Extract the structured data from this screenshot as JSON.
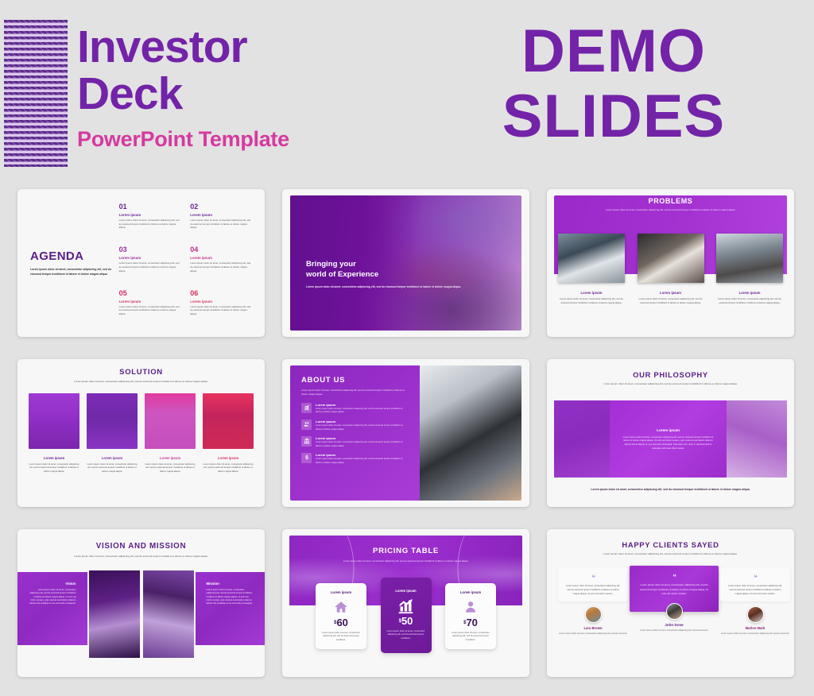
{
  "header": {
    "title_line1": "Investor",
    "title_line2": "Deck",
    "subtitle": "PowerPoint Template",
    "demo_line1": "DEMO",
    "demo_line2": "SLIDES",
    "colors": {
      "purple": "#7323a8",
      "pink": "#d6399f",
      "zigzag_dark": "#5b2a8c",
      "zigzag_light": "#ddc6ee"
    }
  },
  "lorem": {
    "short": "Lorem ipsum",
    "p_small": "Lorem ipsum dolor sit amet, consectetur adipiscing elit, sed do eiusmod tempor incididunt ut labore et dolore magna aliqua.",
    "p_medium": "Lorem ipsum dolor sit amet, consectetur adipiscing elit, sed do eiusmod tempor incididunt ut labore et dolore magna aliqua.",
    "p_long": "Lorem ipsum dolor sit amet, consectetur adipiscing elit, sed do eiusmod tempor incididunt ut labore et dolore magna aliqua. Ut enim ad minim veniam, quis nostrud exercitation ullamco laboris nisi ut aliquip ex ea commodo consequat. Duis aute irure dolor in reprehenderit in voluptate velit esse cillum dolore eu fugiat nulla pariatur.",
    "caption": "Lorem ipsum dolor sit amet, consectetur adipiscing elit, sed do eiusmod tempor incididunt."
  },
  "slides": {
    "agenda": {
      "title": "AGENDA",
      "body": "Lorem ipsum dolor sit amet, consectetur adipiscing elit, sed do eiusmod tempor incididunt ut labore et dolore magna aliqua.",
      "items": [
        {
          "num": "01",
          "label": "Lorem ipsum",
          "color": "#6d2596",
          "text": "Lorem ipsum dolor sit amet, consectetur adipiscing elit, sed do eiusmod tempor incididunt ut labore et dolore magna aliqua."
        },
        {
          "num": "02",
          "label": "Lorem ipsum",
          "color": "#6d2596",
          "text": "Lorem ipsum dolor sit amet, consectetur adipiscing elit, sed do eiusmod tempor incididunt ut labore et dolore magna aliqua."
        },
        {
          "num": "03",
          "label": "Lorem ipsum",
          "color": "#9c2aa0",
          "text": "Lorem ipsum dolor sit amet, consectetur adipiscing elit, sed do eiusmod tempor incididunt ut labore et dolore magna aliqua."
        },
        {
          "num": "04",
          "label": "Lorem ipsum",
          "color": "#c02d8a",
          "text": "Lorem ipsum dolor sit amet, consectetur adipiscing elit, sed do eiusmod tempor incididunt ut labore et dolore magna aliqua."
        },
        {
          "num": "05",
          "label": "Lorem ipsum",
          "color": "#d32f6d",
          "text": "Lorem ipsum dolor sit amet, consectetur adipiscing elit, sed do eiusmod tempor incididunt ut labore et dolore magna aliqua."
        },
        {
          "num": "06",
          "label": "Lorem ipsum",
          "color": "#d8305f",
          "text": "Lorem ipsum dolor sit amet, consectetur adipiscing elit, sed do eiusmod tempor incididunt ut labore et dolore magna aliqua."
        }
      ]
    },
    "hero": {
      "heading_line1": "Bringing your",
      "heading_line2": "world of Experience",
      "text": "Lorem ipsum dolor sit amet, consectetur adipiscing elit, sed do eiusmod tempor incididunt ut labore et dolore magna aliqua."
    },
    "problems": {
      "title": "PROBLEMS",
      "subtitle": "Lorem ipsum dolor sit amet, consectetur adipiscing elit, sed do eiusmod tempor incididunt ut labore et dolore magna aliqua.",
      "cards": [
        {
          "label": "Lorem ipsum",
          "text": "Lorem ipsum dolor sit amet, consectetur adipiscing elit, sed do eiusmod tempor incididunt ut labore et dolore magna aliqua.",
          "photo": "person-writing-document"
        },
        {
          "label": "Lorem ipsum",
          "text": "Lorem ipsum dolor sit amet, consectetur adipiscing elit, sed do eiusmod tempor incididunt ut labore et dolore magna aliqua.",
          "photo": "hand-holding-sign"
        },
        {
          "label": "Lorem ipsum",
          "text": "Lorem ipsum dolor sit amet, consectetur adipiscing elit, sed do eiusmod tempor incididunt ut labore et dolore magna aliqua.",
          "photo": "two-men-meeting"
        }
      ]
    },
    "solution": {
      "title": "SOLUTION",
      "subtitle": "Lorem ipsum dolor sit amet, consectetur adipiscing elit, sed do eiusmod tempor incididunt ut labore et dolore magna aliqua.",
      "cards": [
        {
          "label": "Lorem ipsum",
          "color": "#6d2596",
          "text": "Lorem ipsum dolor sit amet, consectetur adipiscing elit, sed do eiusmod tempor incididunt ut labore et dolore magna aliqua."
        },
        {
          "label": "Lorem ipsum",
          "color": "#7c2aa5",
          "text": "Lorem ipsum dolor sit amet, consectetur adipiscing elit, sed do eiusmod tempor incididunt ut labore et dolore magna aliqua."
        },
        {
          "label": "Lorem ipsum",
          "color": "#c73a9e",
          "text": "Lorem ipsum dolor sit amet, consectetur adipiscing elit, sed do eiusmod tempor incididunt ut labore et dolore magna aliqua."
        },
        {
          "label": "Lorem ipsum",
          "color": "#d4305f",
          "text": "Lorem ipsum dolor sit amet, consectetur adipiscing elit, sed do eiusmod tempor incididunt ut labore et dolore magna aliqua."
        }
      ]
    },
    "about": {
      "title": "ABOUT US",
      "subtitle": "Lorem ipsum dolor sit amet, consectetur adipiscing elit, sed do eiusmod tempor incididunt ut labore et dolore magna aliqua.",
      "items": [
        {
          "icon": "bar-chart-icon",
          "label": "Lorem ipsum",
          "text": "Lorem ipsum dolor sit amet, consectetur adipiscing elit, sed do eiusmod tempor incididunt ut labore et dolore magna aliqua."
        },
        {
          "icon": "people-group-icon",
          "label": "Lorem ipsum",
          "text": "Lorem ipsum dolor sit amet, consectetur adipiscing elit, sed do eiusmod tempor incididunt ut labore et dolore magna aliqua."
        },
        {
          "icon": "bank-building-icon",
          "label": "Lorem ipsum",
          "text": "Lorem ipsum dolor sit amet, consectetur adipiscing elit, sed do eiusmod tempor incididunt ut labore et dolore magna aliqua."
        },
        {
          "icon": "dollar-sign-icon",
          "label": "Lorem ipsum",
          "text": "Lorem ipsum dolor sit amet, consectetur adipiscing elit, sed do eiusmod tempor incididunt ut labore et dolore magna aliqua."
        }
      ],
      "photo": "person-typing-on-laptop"
    },
    "philosophy": {
      "title": "OUR PHILOSOPHY",
      "subtitle": "Lorem ipsum dolor sit amet, consectetur adipiscing elit, sed do eiusmod tempor incididunt ut labore et dolore magna aliqua.",
      "card_label": "Lorem ipsum",
      "card_text": "Lorem ipsum dolor sit amet, consectetur adipiscing elit, sed do eiusmod tempor incididunt ut labore et dolore magna aliqua. Ut enim ad minim veniam, quis nostrud exercitation ullamco laboris nisi ut aliquip ex ea commodo consequat. Duis aute irure dolor in reprehenderit in voluptate velit esse cillum dolore.",
      "footer": "Lorem ipsum dolor sit amet, consectetur adipiscing elit, sed do eiusmod tempor incididunt ut labore et dolore magna aliqua.",
      "photo_left": "greek-temple-columns",
      "photo_right": "notebook-and-pen"
    },
    "vision": {
      "title": "VISION AND MISSION",
      "subtitle": "Lorem ipsum dolor sit amet, consectetur adipiscing elit, sed do eiusmod tempor incididunt ut labore et dolore magna aliqua.",
      "vision_label": "Vision",
      "vision_text": "Lorem ipsum dolor sit amet, consectetur adipiscing elit, sed do eiusmod tempor incididunt ut labore et dolore magna aliqua. Ut enim ad minim veniam, quis nostrud exercitation ullamco laboris nisi ut aliquip ex ea commodo consequat.",
      "mission_label": "Mission",
      "mission_text": "Lorem ipsum dolor sit amet, consectetur adipiscing elit, sed do eiusmod tempor incididunt ut labore et dolore magna aliqua. Ut enim ad minim veniam, quis nostrud exercitation ullamco laboris nisi ut aliquip ex ea commodo consequat.",
      "photo_left": "greek-temple-building",
      "photo_right": "people-at-airport-window"
    },
    "pricing": {
      "title": "PRICING TABLE",
      "subtitle": "Lorem ipsum dolor sit amet, consectetur adipiscing elit, sed do eiusmod tempor incididunt ut labore et dolore magna aliqua.",
      "plans": [
        {
          "name": "Lorem ipsum",
          "icon": "home-icon",
          "currency": "$",
          "price": "60",
          "featured": false,
          "text": "Lorem ipsum dolor sit amet, consectetur adipiscing elit, sed do eiusmod tempor incididunt."
        },
        {
          "name": "Lorem ipsum",
          "icon": "growth-chart-icon",
          "currency": "$",
          "price": "50",
          "featured": true,
          "text": "Lorem ipsum dolor sit amet, consectetur adipiscing elit, sed do eiusmod tempor incididunt."
        },
        {
          "name": "Lorem ipsum",
          "icon": "user-icon",
          "currency": "$",
          "price": "70",
          "featured": false,
          "text": "Lorem ipsum dolor sit amet, consectetur adipiscing elit, sed do eiusmod tempor incididunt."
        }
      ]
    },
    "clients": {
      "title": "HAPPY CLIENTS SAYED",
      "subtitle": "Lorem ipsum dolor sit amet, consectetur adipiscing elit, sed do eiusmod tempor incididunt ut labore et dolore magna aliqua.",
      "quote_glyph": "❝",
      "testimonials": [
        {
          "name": "Lara Brown",
          "quote": "Lorem ipsum dolor sit amet, consectetur adipiscing elit, sed do eiusmod tempor incididunt ut labore et dolore magna aliqua. Ut enim ad minim veniam.",
          "sub": "Lorem ipsum dolor sit amet, consectetur adipiscing elit, sed do eiusmod.",
          "avatar": "woman-blonde-portrait",
          "featured": false
        },
        {
          "name": "John Dove",
          "quote": "Lorem ipsum dolor sit amet, consectetur adipiscing elit, sed do eiusmod tempor incididunt ut labore et dolore magna aliqua. Ut enim ad minim veniam.",
          "sub": "Lorem ipsum dolor sit amet, consectetur adipiscing elit, sed do eiusmod.",
          "avatar": "man-beard-portrait",
          "featured": true
        },
        {
          "name": "Marlon Mark",
          "quote": "Lorem ipsum dolor sit amet, consectetur adipiscing elit, sed do eiusmod tempor incididunt ut labore et dolore magna aliqua. Ut enim ad minim veniam.",
          "sub": "Lorem ipsum dolor sit amet, consectetur adipiscing elit, sed do eiusmod.",
          "avatar": "woman-redhead-portrait",
          "featured": false
        }
      ]
    }
  }
}
